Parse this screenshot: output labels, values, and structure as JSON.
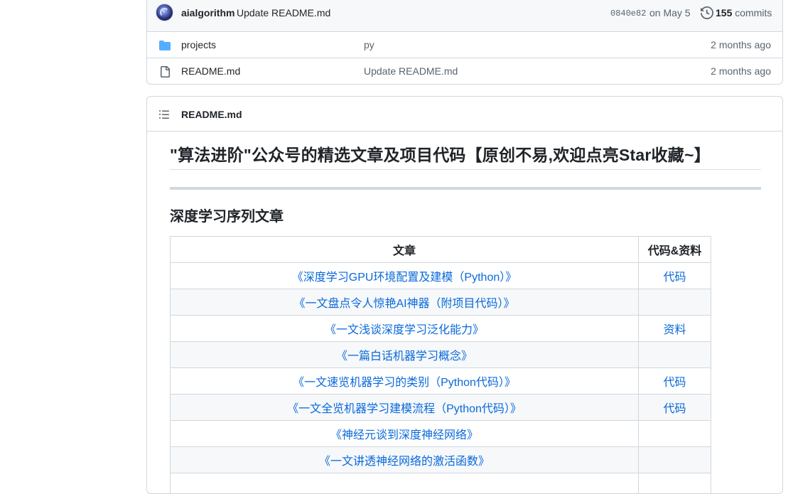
{
  "latest_commit": {
    "author": "aialgorithm",
    "message": "Update README.md",
    "sha": "0840e82",
    "date": "on May 5",
    "count": "155",
    "count_label": "commits"
  },
  "files": [
    {
      "name": "projects",
      "commit": "py",
      "age": "2 months ago",
      "icon": "folder-icon"
    },
    {
      "name": "README.md",
      "commit": "Update README.md",
      "age": "2 months ago",
      "icon": "file-icon"
    }
  ],
  "readme": {
    "filename": "README.md",
    "title": "\"算法进阶\"公众号的精选文章及项目代码【原创不易,欢迎点亮Star收藏~】",
    "section_title": "深度学习序列文章",
    "table": {
      "headers": [
        "文章",
        "代码&资料"
      ],
      "rows": [
        {
          "article": "《深度学习GPU环境配置及建模（Python）》",
          "code": "代码"
        },
        {
          "article": "《一文盘点令人惊艳AI神器（附项目代码）》",
          "code": ""
        },
        {
          "article": "《一文浅谈深度学习泛化能力》",
          "code": "资料"
        },
        {
          "article": "《一篇白话机器学习概念》",
          "code": ""
        },
        {
          "article": "《一文速览机器学习的类别（Python代码）》",
          "code": "代码"
        },
        {
          "article": "《一文全览机器学习建模流程（Python代码）》",
          "code": "代码"
        },
        {
          "article": "《神经元谈到深度神经网络》",
          "code": ""
        },
        {
          "article": "《一文讲透神经网络的激活函数》",
          "code": ""
        },
        {
          "article": "",
          "code": ""
        }
      ]
    }
  },
  "colors": {
    "link": "#0969da",
    "muted": "#59636e",
    "border": "#d0d7de",
    "folder": "#54aeff"
  }
}
